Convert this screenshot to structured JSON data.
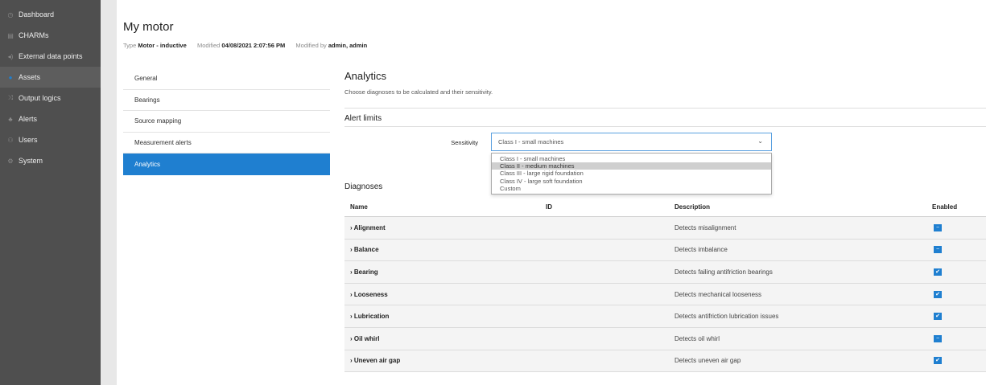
{
  "nav": {
    "items": [
      {
        "label": "Dashboard",
        "icon": "dashboard-icon",
        "glyph": "◷"
      },
      {
        "label": "CHARMs",
        "icon": "charms-icon",
        "glyph": "▤"
      },
      {
        "label": "External data points",
        "icon": "external-data-icon",
        "glyph": "◂)"
      },
      {
        "label": "Assets",
        "icon": "assets-icon",
        "glyph": "●"
      },
      {
        "label": "Output logics",
        "icon": "output-logics-icon",
        "glyph": "⤨"
      },
      {
        "label": "Alerts",
        "icon": "alerts-icon",
        "glyph": "♣"
      },
      {
        "label": "Users",
        "icon": "users-icon",
        "glyph": "⚇"
      },
      {
        "label": "System",
        "icon": "system-icon",
        "glyph": "⚙"
      }
    ],
    "active": "Assets"
  },
  "header": {
    "title": "My motor",
    "type_label": "Type",
    "type_value": "Motor - inductive",
    "modified_label": "Modified",
    "modified_value": "04/08/2021 2:07:56 PM",
    "modified_by_label": "Modified by",
    "modified_by_value": "admin, admin"
  },
  "subnav": {
    "items": [
      "General",
      "Bearings",
      "Source mapping",
      "Measurement alerts",
      "Analytics"
    ],
    "active": "Analytics"
  },
  "main": {
    "heading": "Analytics",
    "description": "Choose diagnoses to be calculated and their sensitivity.",
    "alert_limits_heading": "Alert limits",
    "sensitivity_label": "Sensitivity",
    "sensitivity_value": "Class I - small machines",
    "sensitivity_options": [
      "Class I - small machines",
      "Class II - medium machines",
      "Class III - large rigid foundation",
      "Class IV - large soft foundation",
      "Custom"
    ],
    "highlighted_option": "Class II - medium machines",
    "diagnoses_heading": "Diagnoses",
    "table": {
      "columns": [
        "Name",
        "ID",
        "Description",
        "Enabled"
      ],
      "rows": [
        {
          "name": "› Alignment",
          "id": "",
          "description": "Detects misalignment",
          "enabled": "partial"
        },
        {
          "name": "› Balance",
          "id": "",
          "description": "Detects imbalance",
          "enabled": "partial"
        },
        {
          "name": "› Bearing",
          "id": "",
          "description": "Detects failing antifriction bearings",
          "enabled": "checked"
        },
        {
          "name": "› Looseness",
          "id": "",
          "description": "Detects mechanical looseness",
          "enabled": "checked"
        },
        {
          "name": "› Lubrication",
          "id": "",
          "description": "Detects antifriction lubrication issues",
          "enabled": "checked"
        },
        {
          "name": "› Oil whirl",
          "id": "",
          "description": "Detects oil whirl",
          "enabled": "partial"
        },
        {
          "name": "› Uneven air gap",
          "id": "",
          "description": "Detects uneven air gap",
          "enabled": "checked"
        }
      ]
    }
  },
  "colors": {
    "accent": "#1f7fd0",
    "nav_bg": "#4f4f4f",
    "nav_active": "#5d5d5d"
  }
}
